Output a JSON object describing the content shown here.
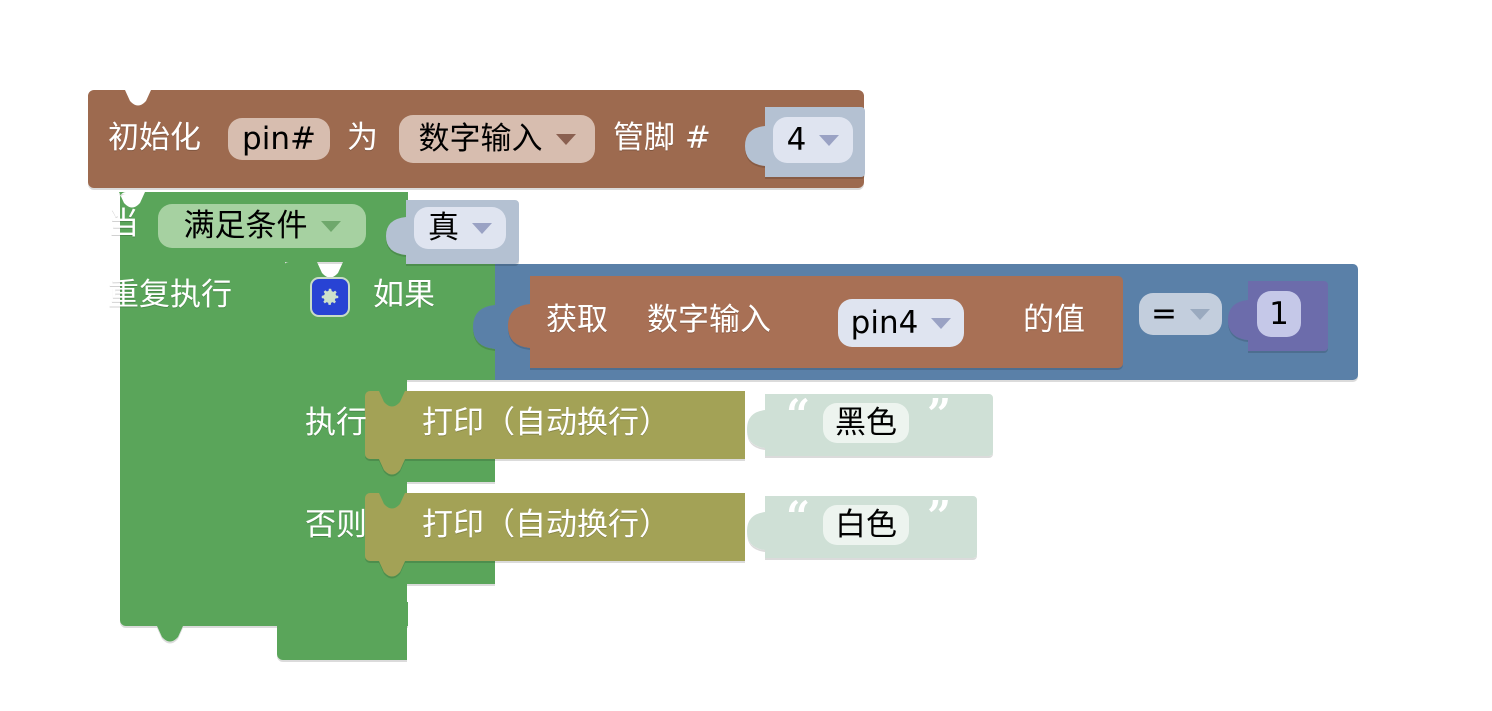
{
  "workspace": {
    "background": "#ffffff",
    "kind": "blockly-visual-programming-canvas"
  },
  "palette": {
    "brown": "#9d6a50",
    "brown_field": "#d7bdaf",
    "green": "#5aa55a",
    "green_field": "#a6d1a1",
    "light_blue": "#b4c1d2",
    "light_blue_field": "#dfe4f0",
    "blue": "#5a80a8",
    "blue_field": "#c3cedd",
    "olive": "#a3a257",
    "mint": "#cfe0d6",
    "mint_field": "#edf4ef",
    "indigo": "#6c6cab",
    "indigo_field": "#c5c8e8",
    "gear_icon": "#2843d4"
  },
  "blocks": {
    "init": {
      "label_1": "初始化",
      "name_field": "pin#",
      "label_2": "为",
      "type_dropdown": "数字输入",
      "label_3": "管脚 #",
      "pin_value": "4"
    },
    "loop": {
      "label_when": "当",
      "mode_dropdown": "满足条件",
      "condition_value": "真",
      "label_repeat": "重复执行"
    },
    "if_block": {
      "gear_icon_name": "gear-icon",
      "label_if": "如果",
      "label_do": "执行",
      "label_else": "否则"
    },
    "condition": {
      "read_label_1": "获取",
      "read_label_2": "数字输入",
      "pin_dropdown": "pin4",
      "read_label_3": "的值",
      "operator": "=",
      "compare_value": "1"
    },
    "do_branch": {
      "print_label": "打印（自动换行）",
      "string_value": "黑色",
      "quote_open": "“",
      "quote_close": "”"
    },
    "else_branch": {
      "print_label": "打印（自动换行）",
      "string_value": "白色",
      "quote_open": "“",
      "quote_close": "”"
    }
  }
}
